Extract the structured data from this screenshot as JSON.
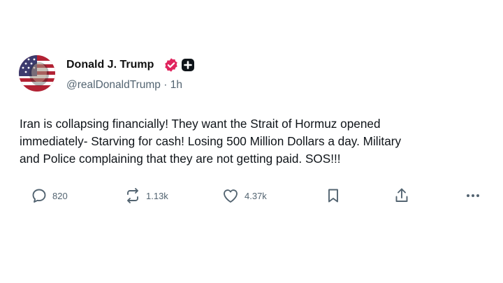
{
  "author": {
    "display_name": "Donald J. Trump",
    "handle": "@realDonaldTrump",
    "separator": "·",
    "timestamp": "1h",
    "verified_badge_color": "#e0245e"
  },
  "post": {
    "text": "Iran is collapsing financially! They want the Strait of Hormuz opened\nimmediately- Starving for cash! Losing 500 Million Dollars a day. Military\nand Police complaining that they are not getting paid. SOS!!!"
  },
  "actions": {
    "replies": "820",
    "reposts": "1.13k",
    "likes": "4.37k",
    "icons": [
      "reply-icon",
      "repost-icon",
      "like-icon",
      "bookmark-icon",
      "share-icon",
      "more-icon"
    ]
  }
}
